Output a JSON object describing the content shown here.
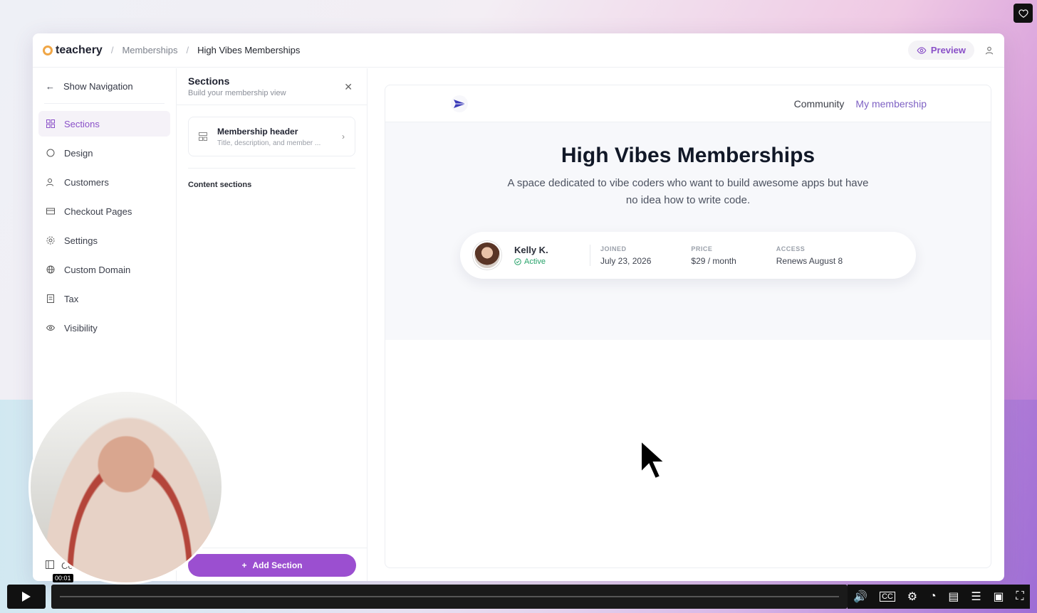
{
  "topbar": {
    "brand": "teachery",
    "breadcrumb": [
      "Memberships",
      "High Vibes Memberships"
    ],
    "preview_label": "Preview"
  },
  "nav": {
    "back_label": "Show Navigation",
    "items": [
      {
        "label": "Sections",
        "icon": "grid-icon"
      },
      {
        "label": "Design",
        "icon": "palette-icon"
      },
      {
        "label": "Customers",
        "icon": "users-icon"
      },
      {
        "label": "Checkout Pages",
        "icon": "credit-card-icon"
      },
      {
        "label": "Settings",
        "icon": "gear-icon"
      },
      {
        "label": "Custom Domain",
        "icon": "globe-icon"
      },
      {
        "label": "Tax",
        "icon": "receipt-icon"
      },
      {
        "label": "Visibility",
        "icon": "eye-icon"
      }
    ],
    "bottom_label": "Co"
  },
  "sections_panel": {
    "title": "Sections",
    "subtitle": "Build your membership view",
    "card": {
      "title": "Membership header",
      "subtitle": "Title, description, and member ..."
    },
    "content_label": "Content sections",
    "add_label": "Add Section"
  },
  "preview": {
    "nav_links": [
      "Community",
      "My membership"
    ],
    "title": "High Vibes Memberships",
    "description": "A space dedicated to vibe coders who want to build awesome apps but have no idea how to write code.",
    "member": {
      "name": "Kelly K.",
      "status": "Active",
      "joined_label": "JOINED",
      "joined": "July 23, 2026",
      "price_label": "PRICE",
      "price": "$29 / month",
      "access_label": "ACCESS",
      "access": "Renews August 8"
    }
  },
  "player": {
    "time": "00:01"
  },
  "colors": {
    "accent": "#9b4fd0",
    "active_green": "#26a269"
  }
}
